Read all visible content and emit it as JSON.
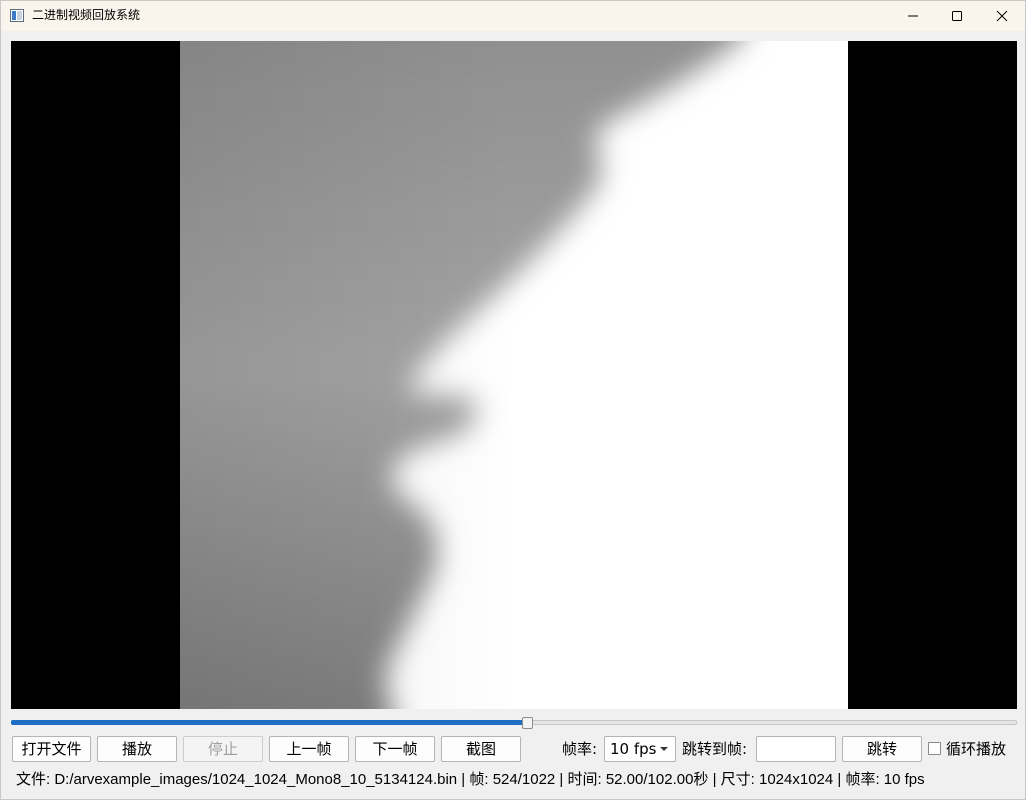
{
  "window": {
    "title": "二进制视频回放系统",
    "icon": "app-icon"
  },
  "video": {
    "frame_current": 524,
    "frame_total": 1022,
    "progress": 0.5127
  },
  "toolbar": {
    "open_label": "打开文件",
    "play_label": "播放",
    "stop_label": "停止",
    "prev_label": "上一帧",
    "next_label": "下一帧",
    "snapshot_label": "截图",
    "fps_label": "帧率:",
    "fps_value": "10 fps",
    "jump_label": "跳转到帧:",
    "jump_value": "",
    "jump_button_label": "跳转",
    "loop_label": "循环播放",
    "loop_checked": false
  },
  "status": {
    "text": "文件: D:/arvexample_images/1024_1024_Mono8_10_5134124.bin | 帧: 524/1022 | 时间: 52.00/102.00秒 | 尺寸: 1024x1024 | 帧率: 10 fps"
  },
  "colors": {
    "accent": "#1e6fc4",
    "titlebar": "#fbf4ec",
    "background": "#f0f0f0"
  }
}
